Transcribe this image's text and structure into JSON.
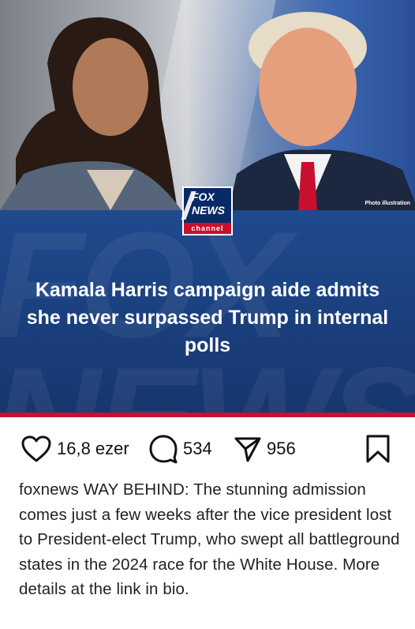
{
  "post": {
    "image": {
      "photo_caption": "Photo illustration",
      "headline": "Kamala Harris campaign aide admits she never surpassed Trump in internal polls",
      "logo": {
        "line1": "FOX",
        "line2": "NEWS",
        "line3": "channel"
      },
      "watermark": [
        "FOX",
        "NEWS"
      ],
      "colors": {
        "panel": "#1f4a8e",
        "accent_red": "#c8102e"
      }
    },
    "actions": {
      "likes": "16,8 ezer",
      "comments": "534",
      "shares": "956",
      "icons": [
        "heart-icon",
        "comment-icon",
        "share-icon",
        "bookmark-icon"
      ]
    },
    "caption": {
      "username": "foxnews",
      "text": "WAY BEHIND: The stunning admission comes just a few weeks after the vice president lost to President-elect Trump, who swept all battleground states in the 2024 race for the White House. More details at the link in bio."
    }
  }
}
